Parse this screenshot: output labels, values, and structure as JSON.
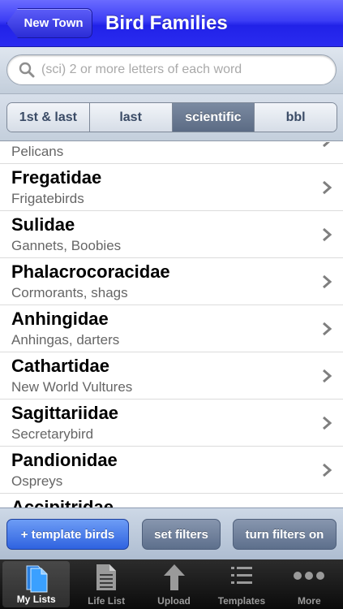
{
  "navbar": {
    "back_label": "New Town",
    "title": "Bird Families"
  },
  "search": {
    "placeholder": "(sci) 2 or more letters of each word",
    "value": ""
  },
  "segments": [
    {
      "label": "1st & last",
      "selected": false
    },
    {
      "label": "last",
      "selected": false
    },
    {
      "label": "scientific",
      "selected": true
    },
    {
      "label": "bbl",
      "selected": false
    }
  ],
  "families": [
    {
      "scientific": "",
      "common": "Pelicans"
    },
    {
      "scientific": "Fregatidae",
      "common": "Frigatebirds"
    },
    {
      "scientific": "Sulidae",
      "common": "Gannets, Boobies"
    },
    {
      "scientific": "Phalacrocoracidae",
      "common": "Cormorants, shags"
    },
    {
      "scientific": "Anhingidae",
      "common": "Anhingas, darters"
    },
    {
      "scientific": "Cathartidae",
      "common": "New World Vultures"
    },
    {
      "scientific": "Sagittariidae",
      "common": "Secretarybird"
    },
    {
      "scientific": "Pandionidae",
      "common": "Ospreys"
    },
    {
      "scientific": "Accipitridae",
      "common": ""
    }
  ],
  "toolbar": {
    "template_birds_label": "+ template birds",
    "set_filters_label": "set filters",
    "filters_on_label": "turn filters on"
  },
  "tabs": [
    {
      "label": "My Lists",
      "icon": "my-lists-icon",
      "active": true
    },
    {
      "label": "Life List",
      "icon": "life-list-icon",
      "active": false
    },
    {
      "label": "Upload",
      "icon": "upload-icon",
      "active": false
    },
    {
      "label": "Templates",
      "icon": "templates-icon",
      "active": false
    },
    {
      "label": "More",
      "icon": "more-icon",
      "active": false
    }
  ],
  "colors": {
    "navbar": "#2a2bf0",
    "selected_segment": "#5b6b84",
    "primary_button": "#2f63e0"
  }
}
